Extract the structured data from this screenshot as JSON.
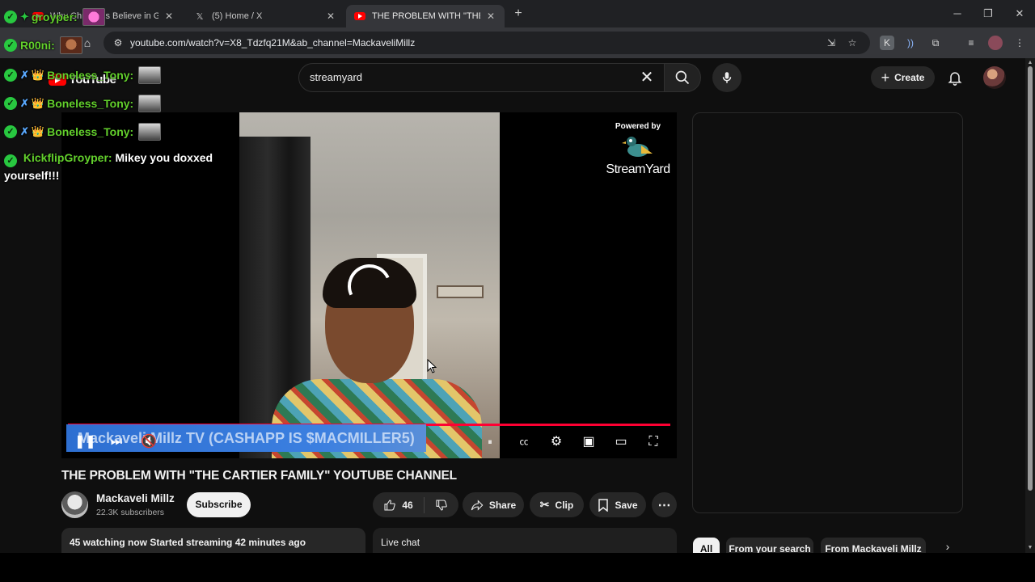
{
  "browser": {
    "tabs": [
      {
        "title": "Why Christians Believe in GOD",
        "active": false
      },
      {
        "title": "(5) Home / X",
        "active": false
      },
      {
        "title": "THE PROBLEM WITH \"THE CARTIER FAMILY\"",
        "active": true
      }
    ],
    "url": "youtube.com/watch?v=X8_Tdzfq21M&ab_channel=MackaveliMillz"
  },
  "youtube": {
    "logo_text": "YouTube",
    "search_query": "streamyard",
    "create_label": "Create",
    "player": {
      "powered_by": "Powered by",
      "brand": "StreamYard",
      "banner": "Mackaveli Millz TV (CASHAPP IS $MACMILLER5)"
    },
    "video_title": "THE PROBLEM WITH \"THE CARTIER FAMILY\" YOUTUBE CHANNEL",
    "channel": {
      "name": "Mackaveli Millz",
      "subscribers": "22.3K subscribers",
      "subscribe_label": "Subscribe"
    },
    "actions": {
      "likes": "46",
      "share": "Share",
      "clip": "Clip",
      "save": "Save"
    },
    "watching": "45 watching now  Started streaming 42 minutes ago",
    "live_chat": "Live chat",
    "chips": [
      "All",
      "From your search",
      "From Mackaveli Millz"
    ]
  },
  "chat_overlay": [
    {
      "user": "groyper:",
      "badge": "✦"
    },
    {
      "user": "R00ni:",
      "badge": ""
    },
    {
      "user": "Boneless_Tony:",
      "badge": "👑"
    },
    {
      "user": "Boneless_Tony:",
      "badge": "👑"
    },
    {
      "user": "Boneless_Tony:",
      "badge": "👑"
    },
    {
      "user": "KickflipGroyper:",
      "message": "Mikey you doxxed yourself!!!"
    }
  ],
  "colors": {
    "youtube_red": "#ff0000",
    "progress": "#ff0033",
    "chat_username": "#63d12c",
    "banner_blue": "#2e6fd1"
  }
}
